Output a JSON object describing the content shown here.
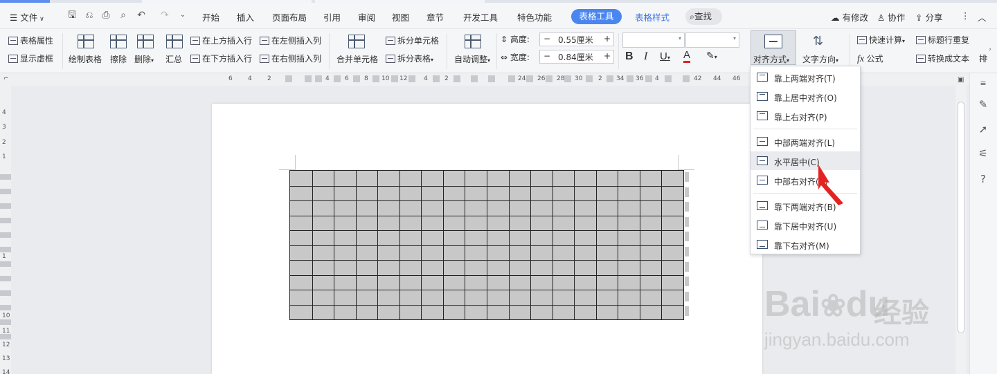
{
  "menu": {
    "file": "文件",
    "tabs": [
      "开始",
      "插入",
      "页面布局",
      "引用",
      "审阅",
      "视图",
      "章节",
      "开发工具",
      "特色功能"
    ],
    "active_tab": "表格工具",
    "style_tab": "表格样式",
    "search": "查找",
    "right": [
      "有修改",
      "协作",
      "分享"
    ]
  },
  "ribbon": {
    "table_props": "表格属性",
    "show_grid": "显示虚框",
    "draw_table": "绘制表格",
    "erase": "擦除",
    "delete": "删除",
    "summary": "汇总",
    "insert_above": "在上方插入行",
    "insert_below": "在下方插入行",
    "insert_left": "在左侧插入列",
    "insert_right": "在右侧插入列",
    "merge_cells": "合并单元格",
    "split_cells": "拆分单元格",
    "split_table": "拆分表格",
    "auto_fit": "自动调整",
    "height_label": "高度:",
    "height_value": "0.55厘米",
    "width_label": "宽度:",
    "width_value": "0.84厘米",
    "bold": "B",
    "italic": "I",
    "underline": "U",
    "font_color": "A",
    "align": "对齐方式",
    "text_direction": "文字方向",
    "quick_calc": "快速计算",
    "formula": "公式",
    "repeat_header": "标题行重复",
    "convert_text": "转换成文本",
    "sort": "排"
  },
  "hruler": [
    "6",
    "4",
    "2",
    "4",
    "6",
    "8",
    "10",
    "12",
    "4",
    "2",
    "24",
    "26",
    "28",
    "30",
    "2",
    "34",
    "36",
    "4",
    "42",
    "44",
    "46"
  ],
  "vruler": [
    "4",
    "3",
    "2",
    "1",
    "1",
    "10",
    "11",
    "12",
    "13",
    "14"
  ],
  "dropdown": {
    "items": [
      {
        "label": "靠上两端对齐(T)",
        "pos": "t"
      },
      {
        "label": "靠上居中对齐(O)",
        "pos": "t"
      },
      {
        "label": "靠上右对齐(P)",
        "pos": "t"
      },
      {
        "label": "中部两端对齐(L)",
        "pos": "m"
      },
      {
        "label": "水平居中(C)",
        "pos": "m"
      },
      {
        "label": "中部右对齐(R)",
        "pos": "m"
      },
      {
        "label": "靠下两端对齐(B)",
        "pos": "b"
      },
      {
        "label": "靠下居中对齐(U)",
        "pos": "b"
      },
      {
        "label": "靠下右对齐(M)",
        "pos": "b"
      }
    ],
    "highlighted": 4
  },
  "table": {
    "rows": 10,
    "cols": 18
  },
  "watermark": {
    "brand": "Bai",
    "brand2": "du",
    "cn": "经验",
    "url": "jingyan.baidu.com"
  },
  "colors": {
    "accent": "#4a86f0",
    "cursor": "#e52222",
    "table_fill": "#c8c8c8"
  }
}
